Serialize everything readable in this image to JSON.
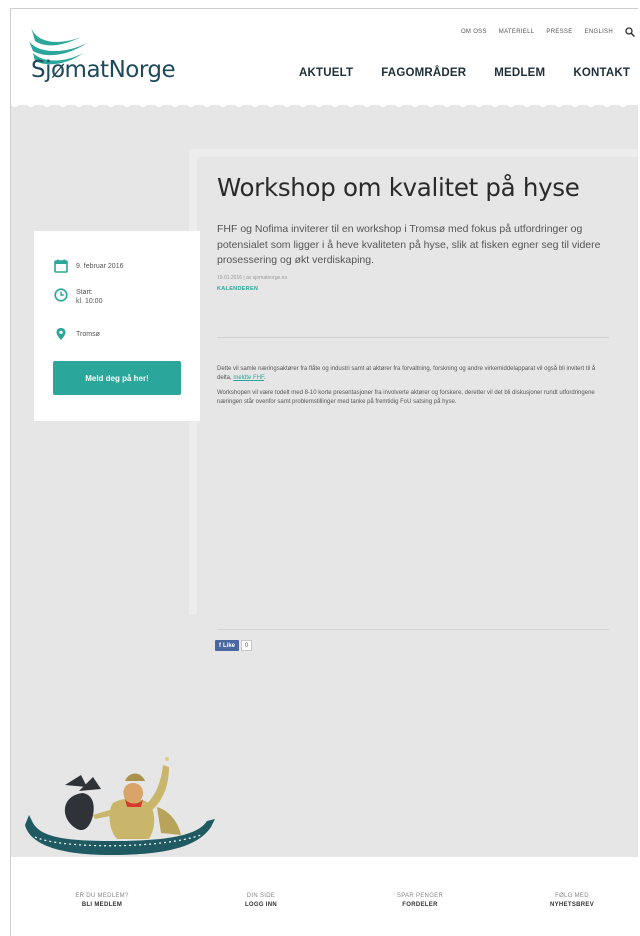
{
  "brand": {
    "name": "SjømatNorge"
  },
  "top_links": [
    "OM OSS",
    "MATERIELL",
    "PRESSE",
    "ENGLISH"
  ],
  "main_nav": [
    "AKTUELT",
    "FAGOMRÅDER",
    "MEDLEM",
    "KONTAKT"
  ],
  "event": {
    "date": "9. februar 2016",
    "start_label": "Start:",
    "start_time": "kl. 10:00",
    "location": "Tromsø",
    "signup_label": "Meld deg på her!"
  },
  "article": {
    "title": "Workshop om kvalitet på hyse",
    "lead": "FHF og Nofima inviterer til en workshop i Tromsø med fokus på utfordringer og potensialet som ligger i å heve kvaliteten på hyse, slik at fisken egner seg til videre prosessering og økt verdiskaping.",
    "meta": "19.01.2016 | av sjomatnorge.no",
    "category": "KALENDEREN",
    "body_p1": "Dette vil samle næringsaktører fra flåte og industri samt at aktører fra forvaltning, forskning og andre virkemiddelapparat vil også bli invitert til å delta,",
    "body_p1_link": "meldte FHF",
    "body_p2": "Workshopen vil være todelt med 8-10 korte presentasjoner fra involverte aktører og forskere, deretter vil det bli diskusjoner rundt utfordringene næringen står ovenfor samt problemstillinger med tanke på fremtidig FoU satsing på hyse."
  },
  "facebook": {
    "like_label": "Like",
    "count": "0"
  },
  "footer": [
    {
      "small": "ER DU MEDLEM?",
      "big": "BLI MEDLEM"
    },
    {
      "small": "DIN SIDE",
      "big": "LOGG INN"
    },
    {
      "small": "SPAR PENGER",
      "big": "FORDELER"
    },
    {
      "small": "FØLG MED",
      "big": "NYHETSBREV"
    }
  ],
  "colors": {
    "accent": "#2aa79a",
    "brand_dark": "#1f4a5c",
    "logo_teal": "#2aa79a"
  }
}
